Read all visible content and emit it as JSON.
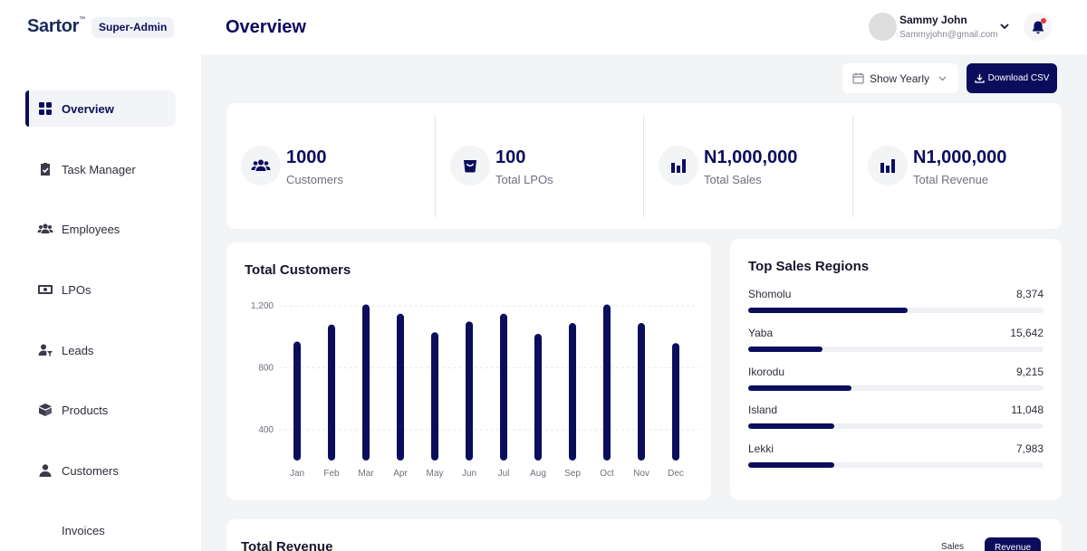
{
  "brand": {
    "name": "Sartor",
    "trademark": "™",
    "role": "Super-Admin"
  },
  "sidebar": {
    "items": [
      {
        "label": "Overview",
        "icon": "grid-icon",
        "active": true
      },
      {
        "label": "Task Manager",
        "icon": "clipboard-check-icon",
        "active": false
      },
      {
        "label": "Employees",
        "icon": "users-icon",
        "active": false
      },
      {
        "label": "LPOs",
        "icon": "money-icon",
        "active": false
      },
      {
        "label": "Leads",
        "icon": "user-filter-icon",
        "active": false
      },
      {
        "label": "Products",
        "icon": "box-icon",
        "active": false
      },
      {
        "label": "Customers",
        "icon": "user-icon",
        "active": false
      },
      {
        "label": "Invoices",
        "icon": "",
        "active": false
      }
    ]
  },
  "header": {
    "title": "Overview",
    "user": {
      "name": "Sammy John",
      "email": "Sammyjohn@gmail.com"
    }
  },
  "toolbar": {
    "period": "Show Yearly",
    "download_label": "Download CSV"
  },
  "stats": [
    {
      "value": "1000",
      "label": "Customers",
      "icon": "users-icon"
    },
    {
      "value": "100",
      "label": "Total LPOs",
      "icon": "basket-icon"
    },
    {
      "value": "N1,000,000",
      "label": "Total Sales",
      "icon": "bar-chart-icon"
    },
    {
      "value": "N1,000,000",
      "label": "Total Revenue",
      "icon": "bar-chart-icon"
    }
  ],
  "chart_data": {
    "type": "bar",
    "title": "Total Customers",
    "categories": [
      "Jan",
      "Feb",
      "Mar",
      "Apr",
      "May",
      "Jun",
      "Jul",
      "Aug",
      "Sep",
      "Oct",
      "Nov",
      "Dec"
    ],
    "values": [
      970,
      1080,
      1210,
      1150,
      1030,
      1100,
      1150,
      1020,
      1090,
      1210,
      1090,
      960
    ],
    "yticks": [
      "1,200",
      "800",
      "400"
    ],
    "ylim": [
      200,
      1260
    ],
    "grid": true,
    "color": "#0b0d5c"
  },
  "regions": {
    "title": "Top Sales Regions",
    "items": [
      {
        "name": "Shomolu",
        "value": "8,374",
        "fraction": 0.54
      },
      {
        "name": "Yaba",
        "value": "15,642",
        "fraction": 0.25
      },
      {
        "name": "Ikorodu",
        "value": "9,215",
        "fraction": 0.35
      },
      {
        "name": "Island",
        "value": "11,048",
        "fraction": 0.29
      },
      {
        "name": "Lekki",
        "value": "7,983",
        "fraction": 0.29
      }
    ]
  },
  "revenue": {
    "title": "Total Revenue",
    "tabs": [
      "Sales",
      "Revenue"
    ]
  },
  "colors": {
    "primary": "#0b0d5c",
    "background": "#f3f4f6",
    "alert": "#e5383b"
  }
}
